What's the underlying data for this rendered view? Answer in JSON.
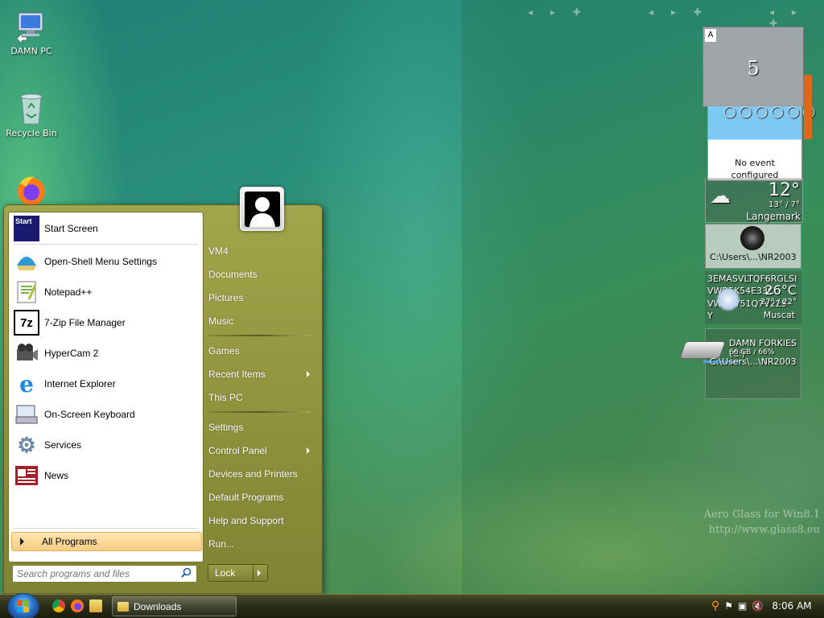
{
  "desktop": {
    "icons": [
      {
        "label": "DAMN PC",
        "icon": "computer-icon"
      },
      {
        "label": "Recycle Bin",
        "icon": "recycle-bin-icon"
      },
      {
        "label": "",
        "icon": "firefox-icon"
      }
    ],
    "watermark": {
      "line1": "Aero Glass for Win8.1",
      "line2": "http://www.glass8.eu"
    }
  },
  "gadgets": {
    "calendar": {
      "tab": "A",
      "day": "5",
      "message_line1": "No event",
      "message_line2": "configured"
    },
    "weather": {
      "temp": "12°",
      "range": "13° / 7°",
      "city": "Langemark"
    },
    "slideshow": {
      "path1": "C:\\Users\\...\\NR2003",
      "path2": "C:\\Users\\...\\NR2003"
    },
    "weather2": {
      "code1": "3EMASVLTQF6RGLSI",
      "code2": "VWB5K54E33C",
      "code3": "VWUCY51Q7V225",
      "code4": "Y",
      "temp": "26°C",
      "range": "27° / 22°",
      "city": "Muscat"
    },
    "drive": {
      "name": "DAMN FORKIES (C:)",
      "usage": "66 GB / 66%"
    }
  },
  "start_menu": {
    "programs": [
      {
        "label": "Start Screen",
        "icon": "start-screen-icon"
      },
      {
        "label": "Open-Shell Menu Settings",
        "icon": "open-shell-icon"
      },
      {
        "label": "Notepad++",
        "icon": "notepadpp-icon"
      },
      {
        "label": "7-Zip File Manager",
        "icon": "7zip-icon"
      },
      {
        "label": "HyperCam 2",
        "icon": "hypercam-icon"
      },
      {
        "label": "Internet Explorer",
        "icon": "internet-explorer-icon"
      },
      {
        "label": "On-Screen Keyboard",
        "icon": "keyboard-icon"
      },
      {
        "label": "Services",
        "icon": "services-icon"
      },
      {
        "label": "News",
        "icon": "news-icon"
      }
    ],
    "all_programs": "All Programs",
    "search_placeholder": "Search programs and files",
    "right_items": [
      {
        "label": "VM4"
      },
      {
        "label": "Documents"
      },
      {
        "label": "Pictures"
      },
      {
        "label": "Music"
      },
      {
        "label": "Games"
      },
      {
        "label": "Recent Items",
        "submenu": true
      },
      {
        "label": "This PC"
      },
      {
        "label": "Settings"
      },
      {
        "label": "Control Panel",
        "submenu": true
      },
      {
        "label": "Devices and Printers"
      },
      {
        "label": "Default Programs"
      },
      {
        "label": "Help and Support"
      },
      {
        "label": "Run..."
      }
    ],
    "lock": "Lock",
    "start_screen_icon_text": "Start"
  },
  "taskbar": {
    "task_label": "Downloads",
    "clock": "8:06 AM"
  }
}
